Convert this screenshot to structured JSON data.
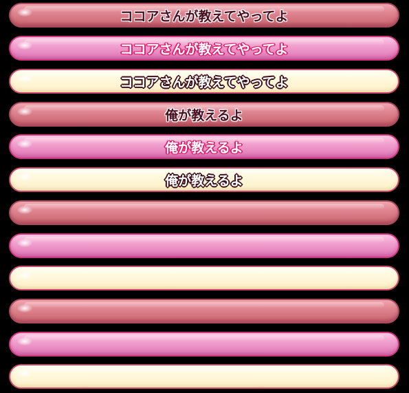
{
  "choices": [
    {
      "label": "ココアさんが教えてやってよ",
      "style": "rose"
    },
    {
      "label": "ココアさんが教えてやってよ",
      "style": "pink"
    },
    {
      "label": "ココアさんが教えてやってよ",
      "style": "cream"
    },
    {
      "label": "俺が教えるよ",
      "style": "rose"
    },
    {
      "label": "俺が教えるよ",
      "style": "pink"
    },
    {
      "label": "俺が教えるよ",
      "style": "cream"
    },
    {
      "label": "",
      "style": "rose"
    },
    {
      "label": "",
      "style": "pink"
    },
    {
      "label": "",
      "style": "cream"
    },
    {
      "label": "",
      "style": "rose"
    },
    {
      "label": "",
      "style": "pink"
    },
    {
      "label": "",
      "style": "cream"
    }
  ],
  "colors": {
    "background": "#000000",
    "rose": "#d3747f",
    "pink": "#e88ac2",
    "cream": "#fff8dc",
    "pink_border": "#d0367e"
  }
}
